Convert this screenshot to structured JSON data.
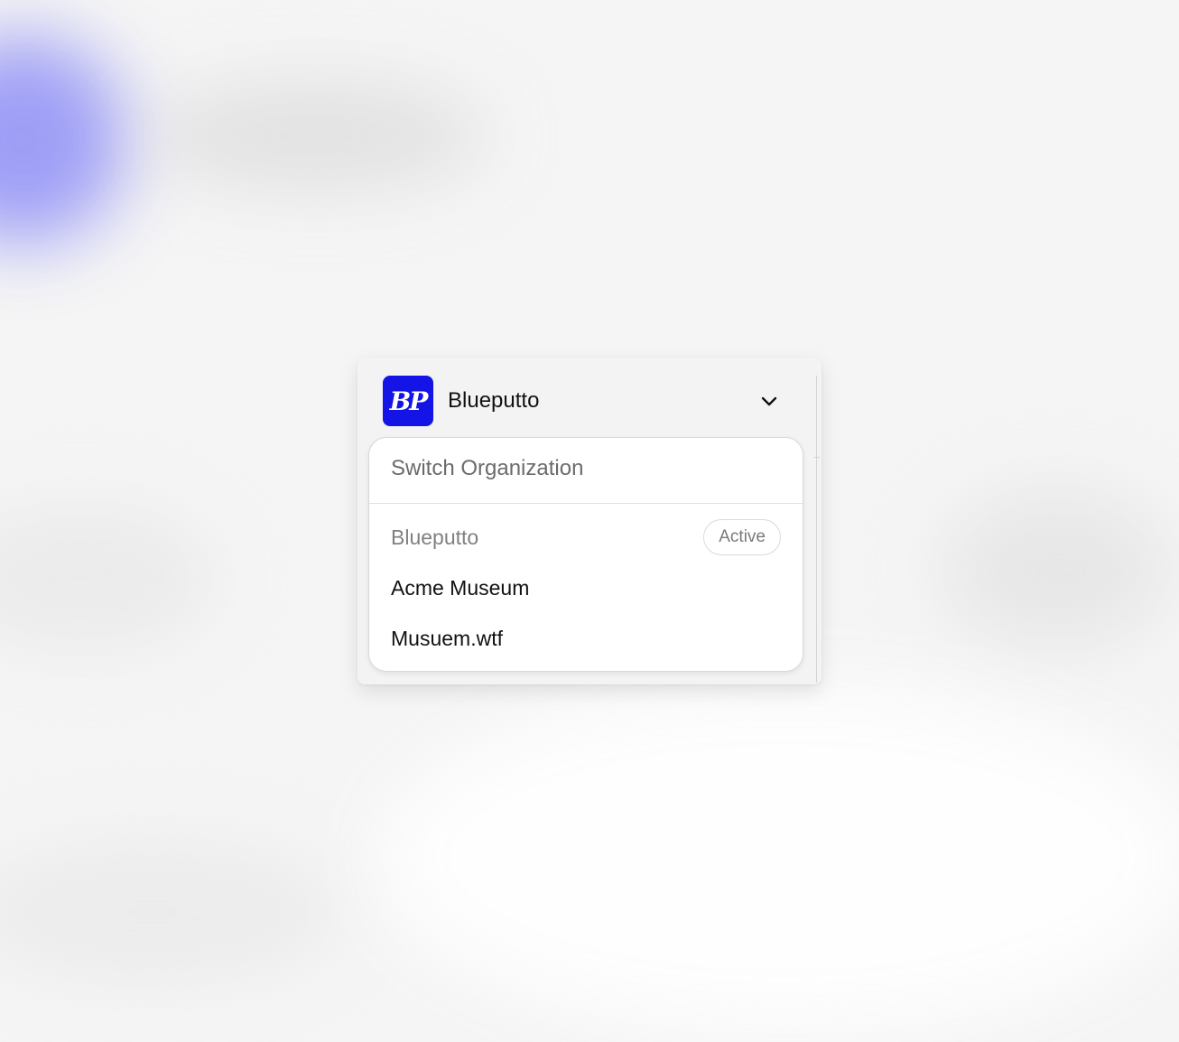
{
  "header": {
    "logo_text": "BP",
    "org_name": "Blueputto",
    "chevron_icon": "chevron-down-icon"
  },
  "dropdown": {
    "title": "Switch Organization",
    "items": [
      {
        "label": "Blueputto",
        "badge": "Active"
      },
      {
        "label": "Acme Museum"
      },
      {
        "label": "Musuem.wtf"
      }
    ]
  },
  "colors": {
    "brand": "#1414e6",
    "muted_text": "#808080"
  }
}
